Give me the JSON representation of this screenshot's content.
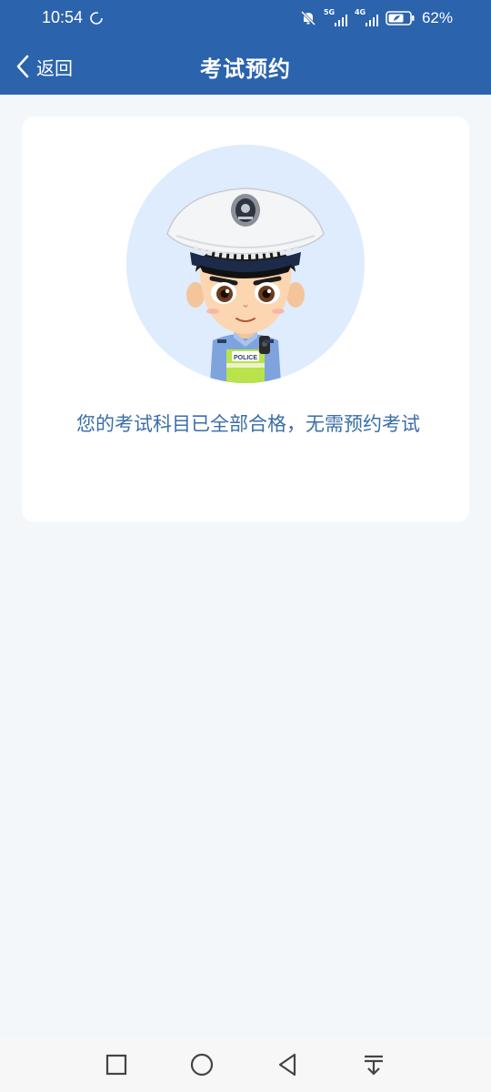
{
  "status_bar": {
    "time": "10:54",
    "network1": "5G",
    "network2": "4G",
    "battery": "62%"
  },
  "header": {
    "back_label": "返回",
    "title": "考试预约"
  },
  "card": {
    "message": "您的考试科目已全部合格，无需预约考试",
    "badge_text": "POLICE"
  },
  "colors": {
    "header_bg": "#2b63ad",
    "page_bg": "#f4f7fa",
    "message_text": "#3a6ea8",
    "avatar_circle": "#deecfd"
  },
  "system_nav": {
    "icons": [
      "recent-apps-icon",
      "home-icon",
      "back-triangle-icon",
      "notification-pulldown-icon"
    ]
  }
}
